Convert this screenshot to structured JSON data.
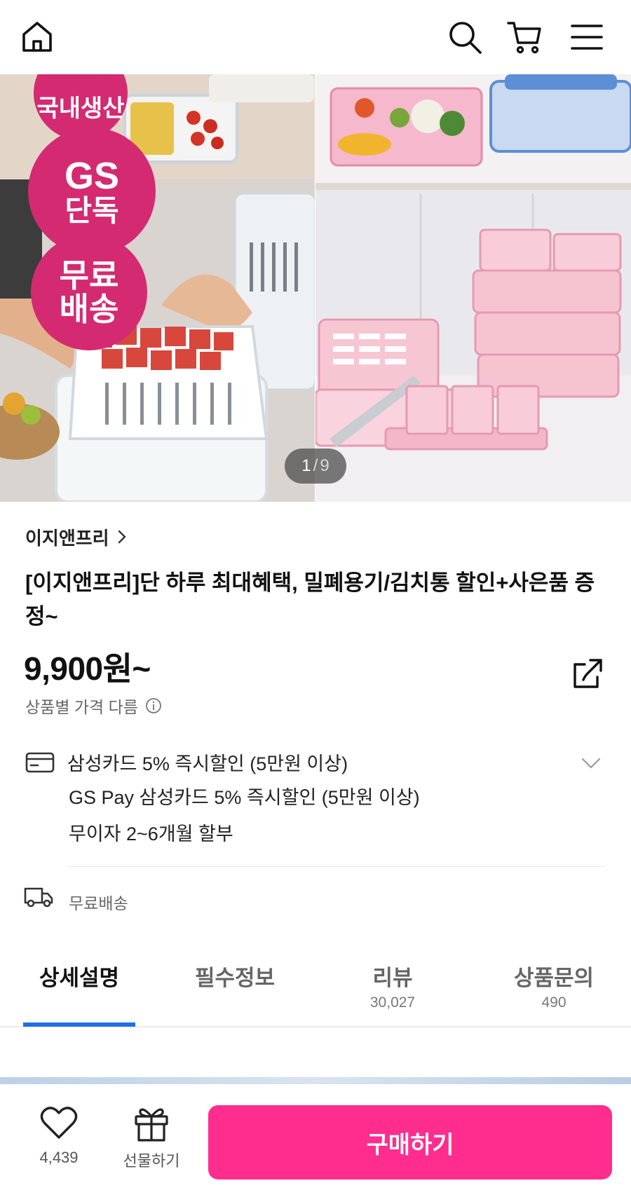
{
  "header": {
    "icons": [
      "home-icon",
      "search-icon",
      "cart-icon",
      "menu-icon"
    ]
  },
  "hero": {
    "badges": {
      "top": "국내생산",
      "middle_line1": "GS",
      "middle_line2": "단독",
      "bottom_line1": "무료",
      "bottom_line2": "배송"
    },
    "pager": {
      "current": "1",
      "separator": "/",
      "total": "9"
    }
  },
  "product": {
    "brand": "이지앤프리",
    "title": "[이지앤프리]단 하루 최대혜택, 밀폐용기/김치통 할인+사은품 증정~",
    "price": "9,900원~",
    "price_note": "상품별 가격 다름"
  },
  "benefits": {
    "card_offer": "삼성카드 5% 즉시할인 (5만원 이상)",
    "gspay_offer": "GS Pay 삼성카드 5% 즉시할인 (5만원 이상)",
    "installment": "무이자 2~6개월 할부"
  },
  "shipping": {
    "label": "무료배송"
  },
  "tabs": [
    {
      "label": "상세설명",
      "count": ""
    },
    {
      "label": "필수정보",
      "count": ""
    },
    {
      "label": "리뷰",
      "count": "30,027"
    },
    {
      "label": "상품문의",
      "count": "490"
    }
  ],
  "bottom_bar": {
    "like_count": "4,439",
    "gift_label": "선물하기",
    "buy_label": "구매하기"
  },
  "colors": {
    "accent_pink": "#ff2d8e",
    "badge_pink": "#d42a72",
    "tab_active_underline": "#1f6fe0"
  }
}
